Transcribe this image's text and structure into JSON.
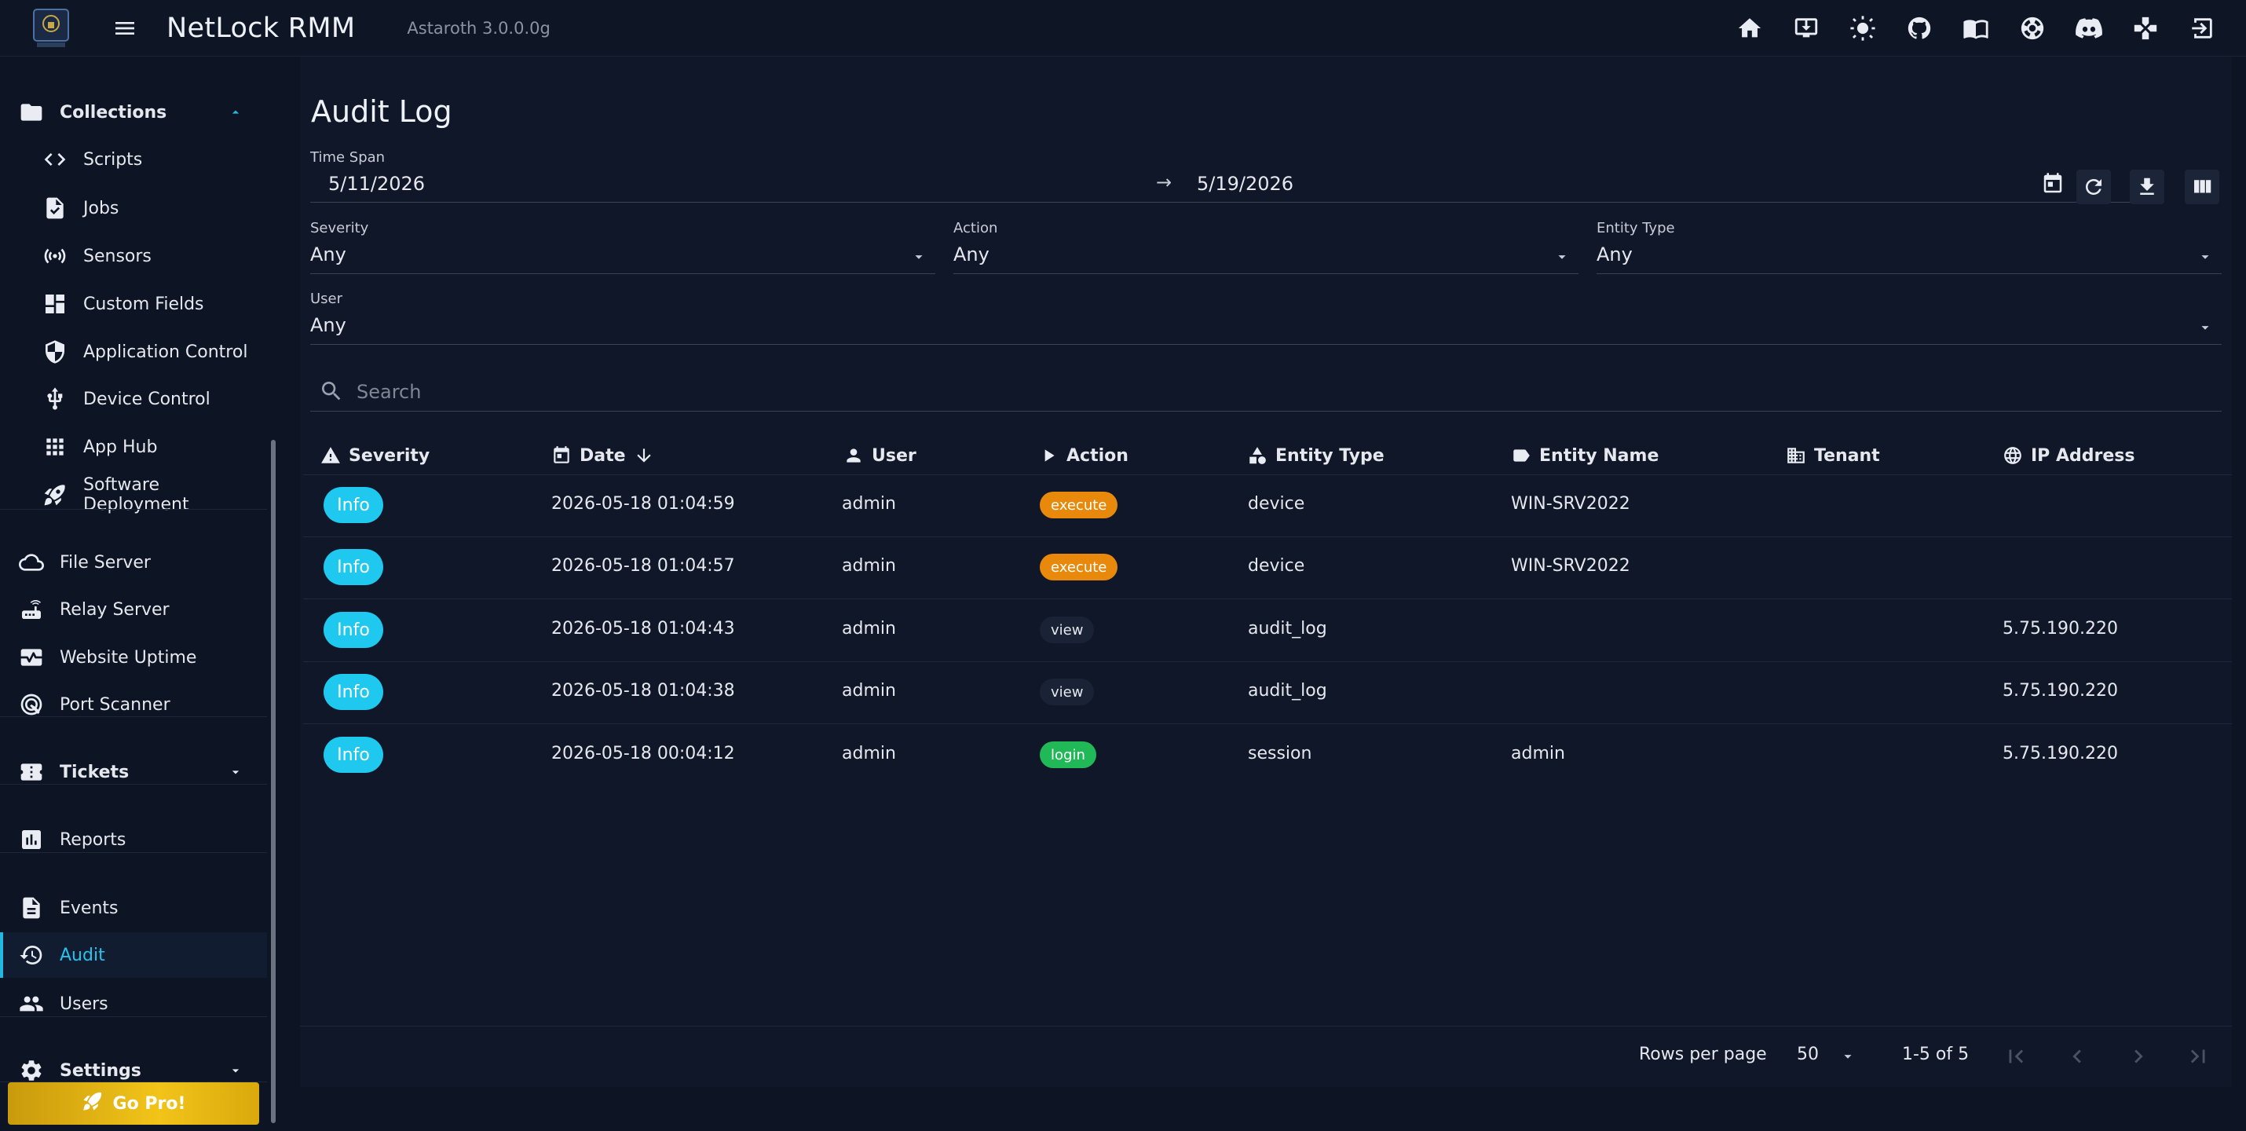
{
  "app": {
    "title": "NetLock RMM",
    "version": "Astaroth 3.0.0.0g",
    "accent": "#22b8e0"
  },
  "topbar_icons": [
    "home-icon",
    "download-agent-icon",
    "theme-light-icon",
    "github-icon",
    "docs-book-icon",
    "support-icon",
    "discord-icon",
    "gamepad-icon",
    "logout-icon"
  ],
  "sidebar": {
    "collections": {
      "label": "Collections",
      "icon": "folder-icon"
    },
    "sub_items": [
      {
        "label": "Scripts",
        "icon": "code-icon"
      },
      {
        "label": "Jobs",
        "icon": "job-icon"
      },
      {
        "label": "Sensors",
        "icon": "sensor-icon"
      },
      {
        "label": "Custom Fields",
        "icon": "dashboard-icon"
      },
      {
        "label": "Application Control",
        "icon": "shield-icon"
      },
      {
        "label": "Device Control",
        "icon": "usb-icon"
      },
      {
        "label": "App Hub",
        "icon": "apps-grid-icon"
      },
      {
        "label": "Software Deployment",
        "icon": "rocket-icon"
      }
    ],
    "group2": [
      {
        "label": "File Server",
        "icon": "cloud-icon"
      },
      {
        "label": "Relay Server",
        "icon": "router-icon"
      },
      {
        "label": "Website Uptime",
        "icon": "monitor-heart-icon"
      },
      {
        "label": "Port Scanner",
        "icon": "radar-icon"
      }
    ],
    "tickets": {
      "label": "Tickets",
      "icon": "ticket-icon"
    },
    "reports": {
      "label": "Reports",
      "icon": "chart-icon"
    },
    "events": {
      "label": "Events",
      "icon": "document-icon"
    },
    "audit": {
      "label": "Audit",
      "icon": "history-icon"
    },
    "users": {
      "label": "Users",
      "icon": "people-icon"
    },
    "settings": {
      "label": "Settings",
      "icon": "gear-icon"
    },
    "gopro": {
      "label": "Go Pro!",
      "icon": "rocket-icon"
    }
  },
  "page": {
    "title": "Audit Log",
    "timespan": {
      "label": "Time Span",
      "start": "5/11/2026",
      "arrow": "→",
      "end": "5/19/2026"
    },
    "filters": {
      "severity": {
        "label": "Severity",
        "value": "Any"
      },
      "action": {
        "label": "Action",
        "value": "Any"
      },
      "entity_type": {
        "label": "Entity Type",
        "value": "Any"
      },
      "user": {
        "label": "User",
        "value": "Any"
      }
    },
    "search": {
      "placeholder": "Search",
      "value": ""
    },
    "columns": {
      "severity": "Severity",
      "date": "Date",
      "user": "User",
      "action": "Action",
      "entity_type": "Entity Type",
      "entity_name": "Entity Name",
      "tenant": "Tenant",
      "ip": "IP Address"
    },
    "rows": [
      {
        "severity": "Info",
        "date": "2026-05-18 01:04:59",
        "user": "admin",
        "action": "execute",
        "entity_type": "device",
        "entity_name": "WIN-SRV2022",
        "tenant": "",
        "ip": ""
      },
      {
        "severity": "Info",
        "date": "2026-05-18 01:04:57",
        "user": "admin",
        "action": "execute",
        "entity_type": "device",
        "entity_name": "WIN-SRV2022",
        "tenant": "",
        "ip": ""
      },
      {
        "severity": "Info",
        "date": "2026-05-18 01:04:43",
        "user": "admin",
        "action": "view",
        "entity_type": "audit_log",
        "entity_name": "",
        "tenant": "",
        "ip": "5.75.190.220"
      },
      {
        "severity": "Info",
        "date": "2026-05-18 01:04:38",
        "user": "admin",
        "action": "view",
        "entity_type": "audit_log",
        "entity_name": "",
        "tenant": "",
        "ip": "5.75.190.220"
      },
      {
        "severity": "Info",
        "date": "2026-05-18 00:04:12",
        "user": "admin",
        "action": "login",
        "entity_type": "session",
        "entity_name": "admin",
        "tenant": "",
        "ip": "5.75.190.220"
      }
    ],
    "pagination": {
      "rows_per_page_label": "Rows per page",
      "rows_per_page": "50",
      "range": "1-5 of 5"
    }
  }
}
